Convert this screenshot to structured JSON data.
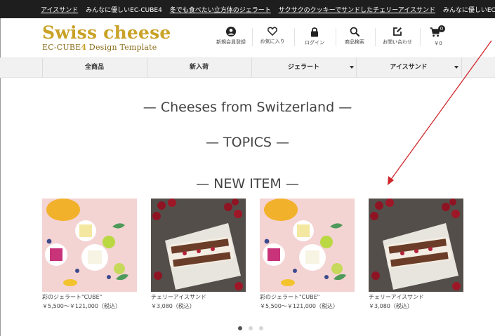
{
  "ticker": {
    "items": [
      {
        "text": "アイスサンド",
        "link": true
      },
      {
        "text": "みんなに優しいEC-CUBE4",
        "link": false
      },
      {
        "text": "冬でも食べたい立方体のジェラート",
        "link": true
      },
      {
        "text": "サクサクのクッキーでサンドしたチェリーアイスサンド",
        "link": true
      },
      {
        "text": "みんなに優しいEC-CUBE",
        "link": false
      }
    ]
  },
  "header": {
    "logo_title": "Swiss cheese",
    "logo_sub_prefix": "EC-CUBE",
    "logo_sub_num": "4",
    "logo_sub_suffix": " Design Template",
    "nav": [
      {
        "label": "新規会員登録",
        "icon": "user-icon"
      },
      {
        "label": "お気に入り",
        "icon": "heart-icon"
      },
      {
        "label": "ログイン",
        "icon": "lock-icon"
      },
      {
        "label": "商品検索",
        "icon": "search-icon"
      },
      {
        "label": "お問い合わせ",
        "icon": "edit-icon"
      },
      {
        "label": "￥0",
        "icon": "cart-icon",
        "badge": "0"
      }
    ]
  },
  "gnav": {
    "items": [
      {
        "label": "全商品",
        "dropdown": false
      },
      {
        "label": "新入荷",
        "dropdown": false
      },
      {
        "label": "ジェラート",
        "dropdown": true
      },
      {
        "label": "アイスサンド",
        "dropdown": true
      }
    ]
  },
  "sections": {
    "cheeses": "Cheeses from Switzerland",
    "topics": "TOPICS",
    "new_item": "NEW ITEM",
    "dash": "—"
  },
  "products": [
    {
      "name": "彩のジェラート\"CUBE\"",
      "price": "￥5,500～￥121,000（税込）",
      "image": "gelato-image"
    },
    {
      "name": "チェリーアイスサンド",
      "price": "￥3,080（税込）",
      "image": "cherry-sandwich-image"
    },
    {
      "name": "彩のジェラート\"CUBE\"",
      "price": "￥5,500～￥121,000（税込）",
      "image": "gelato-image"
    },
    {
      "name": "チェリーアイスサンド",
      "price": "￥3,080（税込）",
      "image": "cherry-sandwich-image"
    }
  ],
  "carousel": {
    "active_index": 0,
    "count": 3
  },
  "colors": {
    "brand": "#c9a227",
    "ticker_bg": "#1e1e1e",
    "annotation_arrow": "#d0262b"
  }
}
